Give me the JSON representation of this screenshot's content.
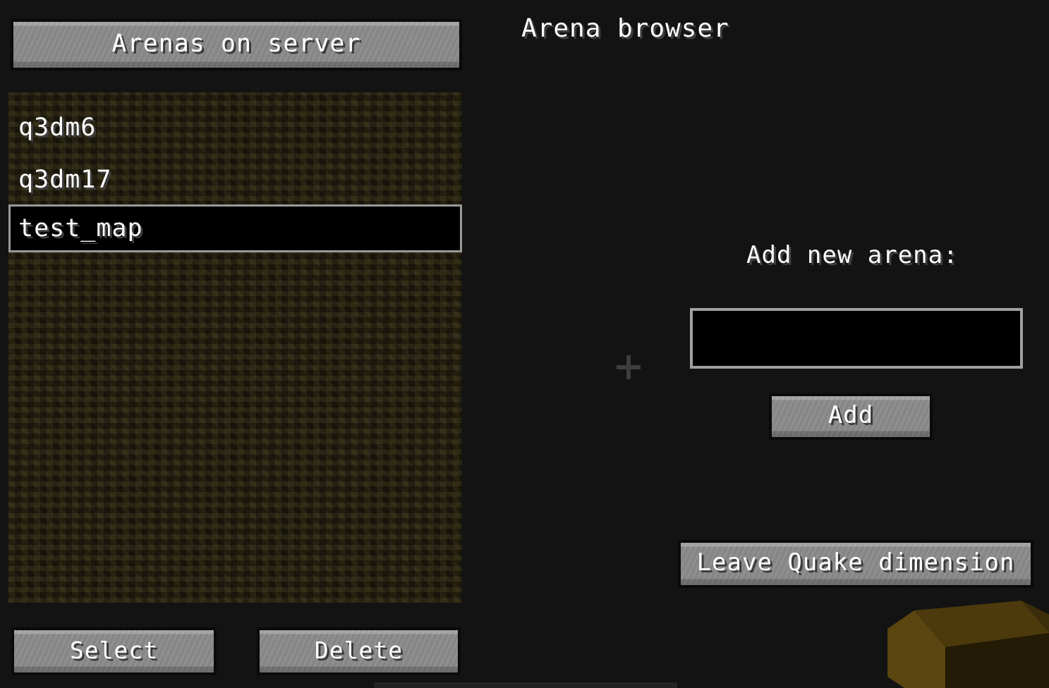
{
  "window": {
    "background_color": "#131313"
  },
  "left_panel": {
    "header_button": {
      "label": "Arenas on server"
    },
    "list": {
      "background_color": "#1e1a0d",
      "selected_index": 2,
      "items": [
        {
          "label": "q3dm6",
          "selected": false
        },
        {
          "label": "q3dm17",
          "selected": false
        },
        {
          "label": "test_map",
          "selected": true
        }
      ]
    },
    "buttons": [
      {
        "label": "Select",
        "name": "select-button"
      },
      {
        "label": "Delete",
        "name": "delete-button"
      }
    ]
  },
  "right_panel": {
    "title": "Arena browser",
    "add_section": {
      "label": "Add new arena:",
      "input": {
        "value": "",
        "placeholder": ""
      },
      "add_button_label": "Add"
    },
    "leave_button_label": "Leave Quake dimension"
  },
  "hud": {
    "crosshair_icon": "crosshair-icon",
    "crosshair_color": "#3d3d3d",
    "held_item_icon": "held-block-item"
  }
}
